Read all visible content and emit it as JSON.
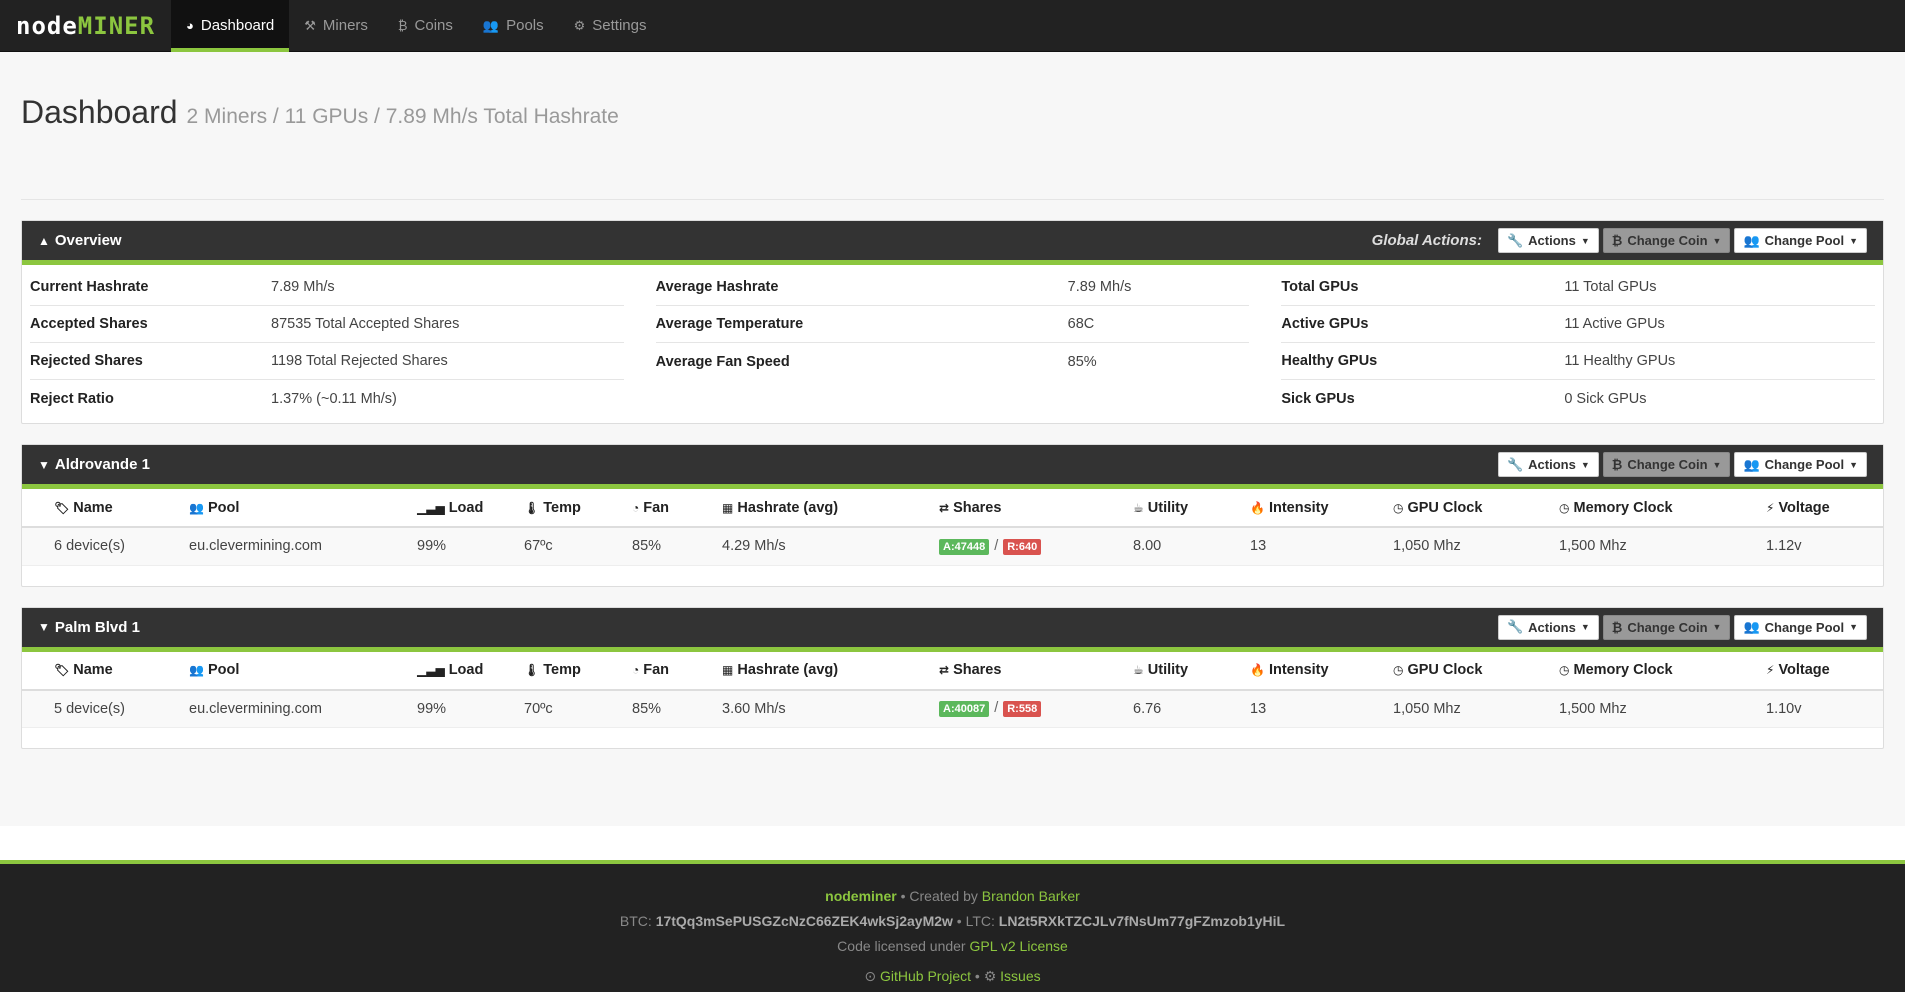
{
  "nav": {
    "brand_part1": "node",
    "brand_part2": "MINER",
    "items": [
      {
        "label": "Dashboard",
        "icon": "dashboard-icon",
        "glyph": "◕",
        "active": true
      },
      {
        "label": "Miners",
        "icon": "hammer-icon",
        "glyph": "⚒",
        "active": false
      },
      {
        "label": "Coins",
        "icon": "bitcoin-icon",
        "glyph": "₿",
        "active": false
      },
      {
        "label": "Pools",
        "icon": "users-icon",
        "glyph": "👥",
        "active": false
      },
      {
        "label": "Settings",
        "icon": "gear-icon",
        "glyph": "⚙",
        "active": false
      }
    ]
  },
  "header": {
    "title": "Dashboard",
    "subtitle": "2 Miners / 11 GPUs / 7.89 Mh/s Total Hashrate"
  },
  "buttons": {
    "actions": "Actions",
    "change_coin": "Change Coin",
    "change_pool": "Change Pool",
    "global_actions": "Global Actions:"
  },
  "overview": {
    "title": "Overview",
    "col1": [
      {
        "k": "Current Hashrate",
        "v": "7.89 Mh/s"
      },
      {
        "k": "Accepted Shares",
        "v": "87535 Total Accepted Shares"
      },
      {
        "k": "Rejected Shares",
        "v": "1198 Total Rejected Shares"
      },
      {
        "k": "Reject Ratio",
        "v": "1.37% (~0.11 Mh/s)"
      }
    ],
    "col2": [
      {
        "k": "Average Hashrate",
        "v": "7.89 Mh/s"
      },
      {
        "k": "Average Temperature",
        "v": "68C"
      },
      {
        "k": "Average Fan Speed",
        "v": "85%"
      }
    ],
    "col3": [
      {
        "k": "Total GPUs",
        "v": "11 Total GPUs"
      },
      {
        "k": "Active GPUs",
        "v": "11 Active GPUs"
      },
      {
        "k": "Healthy GPUs",
        "v": "11 Healthy GPUs"
      },
      {
        "k": "Sick GPUs",
        "v": "0 Sick GPUs"
      }
    ]
  },
  "columns": {
    "name": "Name",
    "pool": "Pool",
    "load": "Load",
    "temp": "Temp",
    "fan": "Fan",
    "hashrate": "Hashrate (avg)",
    "shares": "Shares",
    "utility": "Utility",
    "intensity": "Intensity",
    "gpu_clock": "GPU Clock",
    "memory_clock": "Memory Clock",
    "voltage": "Voltage"
  },
  "miners": [
    {
      "title": "Aldrovande 1",
      "row": {
        "name": "6 device(s)",
        "pool": "eu.clevermining.com",
        "load": "99%",
        "temp": "67ºc",
        "fan": "85%",
        "hashrate": "4.29 Mh/s",
        "accepted": "A:47448",
        "rejected": "R:640",
        "utility": "8.00",
        "intensity": "13",
        "gpu_clock": "1,050 Mhz",
        "memory_clock": "1,500 Mhz",
        "voltage": "1.12v"
      }
    },
    {
      "title": "Palm Blvd 1",
      "row": {
        "name": "5 device(s)",
        "pool": "eu.clevermining.com",
        "load": "99%",
        "temp": "70ºc",
        "fan": "85%",
        "hashrate": "3.60 Mh/s",
        "accepted": "A:40087",
        "rejected": "R:558",
        "utility": "6.76",
        "intensity": "13",
        "gpu_clock": "1,050 Mhz",
        "memory_clock": "1,500 Mhz",
        "voltage": "1.10v"
      }
    }
  ],
  "footer": {
    "project": "nodeminer",
    "created_by": " • Created by ",
    "author": "Brandon Barker",
    "btc_label": "BTC: ",
    "btc_addr": "17tQq3mSePUSGZcNzC66ZEK4wkSj2ayM2w",
    "ltc_label": " • LTC: ",
    "ltc_addr": "LN2t5RXkTZCJLv7fNsUm77gFZmzob1yHiL",
    "license_prefix": "Code licensed under ",
    "license": "GPL v2 License",
    "github": "GitHub Project",
    "sep": " • ",
    "issues": "Issues"
  },
  "colors": {
    "accent": "#8cc63f",
    "nav_bg": "#222222",
    "accepted": "#5cb85c",
    "rejected": "#d9534f"
  }
}
